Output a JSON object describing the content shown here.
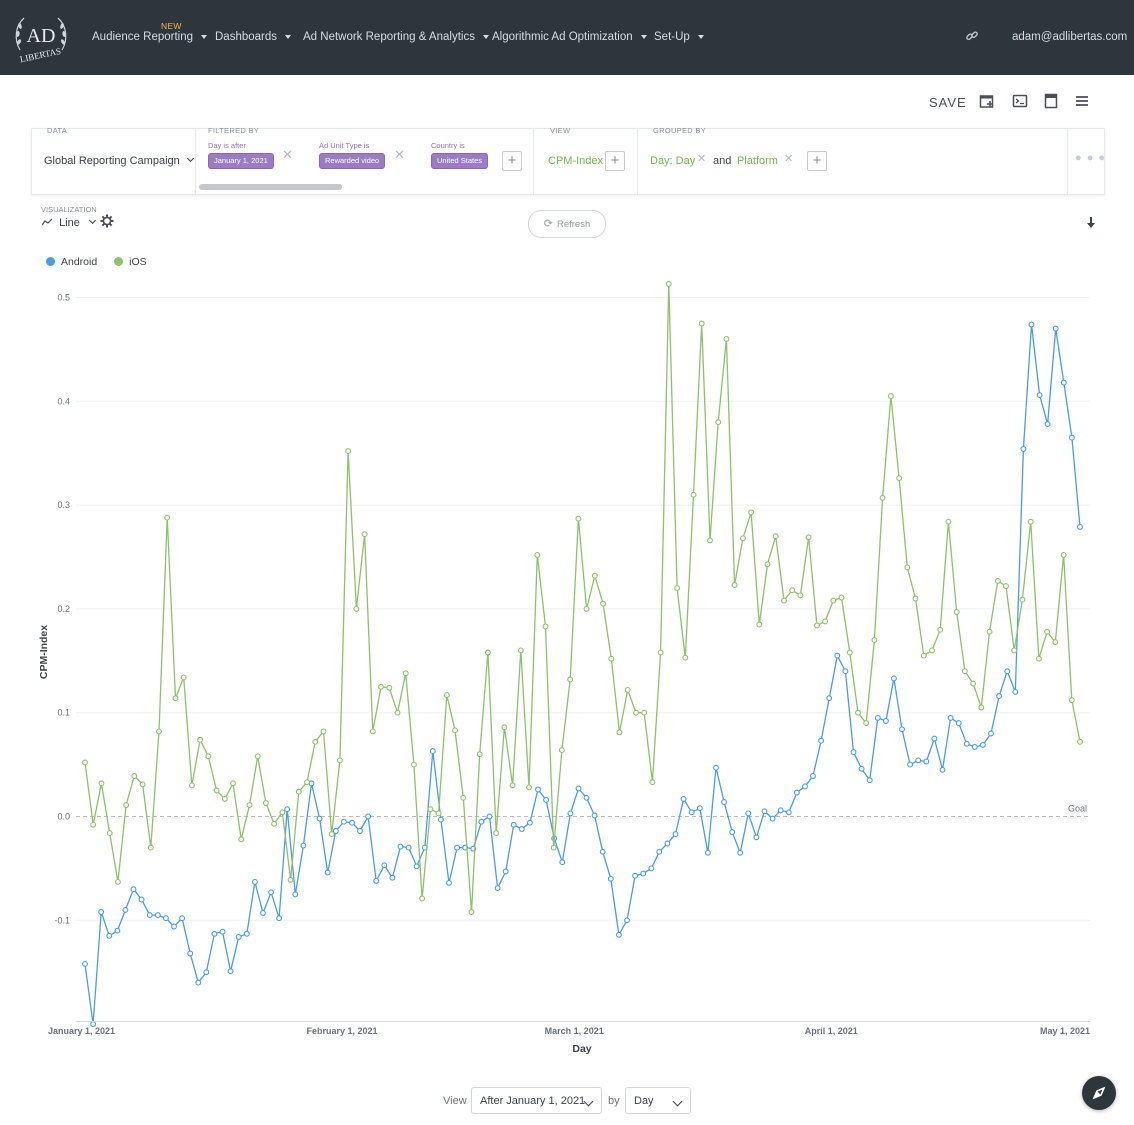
{
  "nav": {
    "logo_text": "AD LIBERTAS",
    "new_badge": "NEW",
    "items": [
      {
        "label": "Audience Reporting"
      },
      {
        "label": "Dashboards"
      },
      {
        "label": "Ad Network Reporting & Analytics"
      },
      {
        "label": "Algorithmic Ad Optimization"
      },
      {
        "label": "Set-Up"
      }
    ],
    "link_icon": "link-icon",
    "user_email": "adam@adlibertas.com"
  },
  "toolbar": {
    "save_label": "SAVE",
    "icons": [
      "add-to-dashboard-icon",
      "terminal-icon",
      "book-icon",
      "menu-icon"
    ]
  },
  "query": {
    "data_label": "DATA",
    "data_value": "Global Reporting Campaign",
    "filtered_by_label": "FILTERED BY",
    "filters": [
      {
        "label": "Day is after",
        "value": "January 1, 2021"
      },
      {
        "label": "Ad Unit Type is",
        "value": "Rewarded video"
      },
      {
        "label": "Country is",
        "value": "United States"
      }
    ],
    "view_label": "VIEW",
    "view_value": "CPM-Index",
    "grouped_by_label": "GROUPED BY",
    "group_1": "Day: Day",
    "group_and": "and",
    "group_2": "Platform"
  },
  "visualization": {
    "label": "VISUALIZATION",
    "value": "Line",
    "refresh_label": "Refresh"
  },
  "legend": [
    {
      "name": "Android",
      "color": "#4a9de0"
    },
    {
      "name": "iOS",
      "color": "#8fc06a"
    }
  ],
  "chart_data": {
    "type": "line",
    "ylabel": "CPM-Index",
    "xlabel": "Day",
    "ylim": [
      -0.2,
      0.52
    ],
    "yticks": [
      -0.1,
      0.0,
      0.1,
      0.2,
      0.3,
      0.4,
      0.5
    ],
    "ytick_labels": [
      "-0.1",
      "0.0",
      "0.1",
      "0.2",
      "0.3",
      "0.4",
      "0.5"
    ],
    "xtick_labels": [
      "January 1, 2021",
      "February 1, 2021",
      "March 1, 2021",
      "April 1, 2021",
      "May 1, 2021"
    ],
    "xtick_days": [
      0,
      31,
      59,
      90,
      120
    ],
    "goal_label": "Goal",
    "goal_value": 0.0,
    "grid": true,
    "series": [
      {
        "name": "Android",
        "color": "#4a9de0",
        "values": [
          -0.142,
          -0.2,
          -0.092,
          -0.115,
          -0.11,
          -0.09,
          -0.07,
          -0.08,
          -0.095,
          -0.095,
          -0.098,
          -0.106,
          -0.098,
          -0.132,
          -0.16,
          -0.15,
          -0.113,
          -0.111,
          -0.149,
          -0.116,
          -0.113,
          -0.063,
          -0.093,
          -0.073,
          -0.098,
          0.007,
          -0.075,
          -0.028,
          0.032,
          -0.002,
          -0.054,
          -0.014,
          -0.005,
          -0.006,
          -0.014,
          0.0,
          -0.062,
          -0.047,
          -0.059,
          -0.029,
          -0.03,
          -0.048,
          -0.03,
          0.063,
          -0.003,
          -0.064,
          -0.03,
          -0.03,
          -0.031,
          -0.005,
          0.0,
          -0.069,
          -0.053,
          -0.008,
          -0.012,
          -0.006,
          0.026,
          0.016,
          -0.021,
          -0.044,
          0.003,
          0.027,
          0.018,
          0.001,
          -0.034,
          -0.06,
          -0.114,
          -0.1,
          -0.057,
          -0.055,
          -0.05,
          -0.034,
          -0.026,
          -0.017,
          0.017,
          0.004,
          0.008,
          -0.035,
          0.047,
          0.014,
          -0.015,
          -0.035,
          0.003,
          -0.02,
          0.005,
          -0.002,
          0.006,
          0.004,
          0.023,
          0.029,
          0.039,
          0.073,
          0.114,
          0.155,
          0.14,
          0.062,
          0.046,
          0.035,
          0.095,
          0.092,
          0.133,
          0.084,
          0.05,
          0.054,
          0.053,
          0.075,
          0.045,
          0.095,
          0.09,
          0.07,
          0.067,
          0.069,
          0.08,
          0.116,
          0.14,
          0.12,
          0.354,
          0.474,
          0.406,
          0.378,
          0.47,
          0.418,
          0.365,
          0.279
        ]
      },
      {
        "name": "iOS",
        "color": "#8fc06a",
        "values": [
          0.052,
          -0.008,
          0.032,
          -0.016,
          -0.063,
          0.011,
          0.039,
          0.031,
          -0.03,
          0.082,
          0.288,
          0.114,
          0.134,
          0.03,
          0.074,
          0.058,
          0.025,
          0.017,
          0.032,
          -0.022,
          0.011,
          0.058,
          0.013,
          -0.007,
          0.004,
          -0.061,
          0.024,
          0.033,
          0.072,
          0.082,
          -0.017,
          0.054,
          0.352,
          0.2,
          0.272,
          0.082,
          0.125,
          0.124,
          0.1,
          0.138,
          0.05,
          -0.079,
          0.007,
          0.003,
          0.117,
          0.083,
          0.018,
          -0.092,
          0.06,
          0.158,
          -0.016,
          0.086,
          0.03,
          0.16,
          0.028,
          0.252,
          0.183,
          -0.03,
          0.064,
          0.132,
          0.287,
          0.2,
          0.232,
          0.205,
          0.152,
          0.081,
          0.122,
          0.1,
          0.1,
          0.033,
          0.158,
          0.513,
          0.22,
          0.153,
          0.31,
          0.475,
          0.266,
          0.38,
          0.46,
          0.223,
          0.268,
          0.293,
          0.185,
          0.243,
          0.27,
          0.208,
          0.218,
          0.213,
          0.269,
          0.184,
          0.188,
          0.208,
          0.211,
          0.158,
          0.1,
          0.09,
          0.17,
          0.307,
          0.405,
          0.326,
          0.24,
          0.21,
          0.155,
          0.16,
          0.18,
          0.284,
          0.197,
          0.14,
          0.128,
          0.105,
          0.178,
          0.227,
          0.222,
          0.16,
          0.209,
          0.284,
          0.152,
          0.178,
          0.168,
          0.252,
          0.112,
          0.072
        ]
      }
    ]
  },
  "footer": {
    "view_label": "View",
    "range_value": "After January 1, 2021",
    "by_label": "by",
    "granularity_value": "Day"
  }
}
